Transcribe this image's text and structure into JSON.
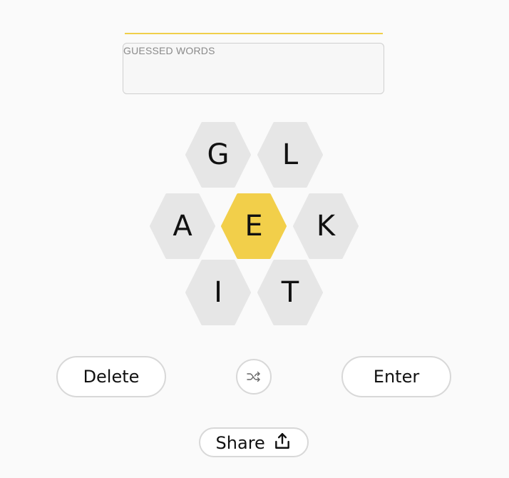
{
  "guessed_words": {
    "label": "GUESSED WORDS",
    "words": []
  },
  "hive": {
    "center_letter": "E",
    "outer_letters": [
      "G",
      "L",
      "A",
      "K",
      "I",
      "T"
    ],
    "center_color": "#f2cf4a",
    "outer_color": "#e6e6e6"
  },
  "controls": {
    "delete_label": "Delete",
    "enter_label": "Enter",
    "share_label": "Share"
  },
  "icons": {
    "shuffle": "shuffle-icon",
    "share": "share-upload-icon"
  },
  "accent_color": "#f0cf4a"
}
